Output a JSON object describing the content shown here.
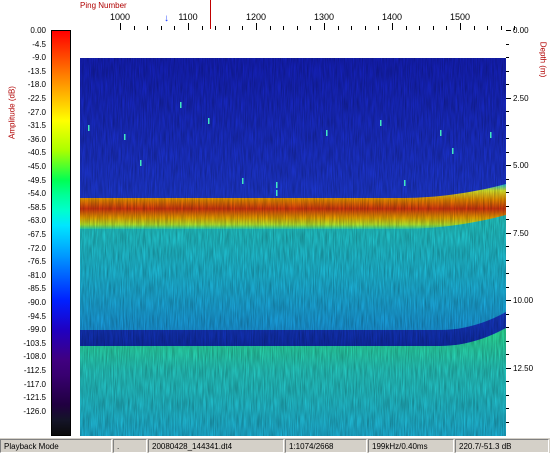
{
  "amplitude_axis": {
    "title": "Amplitude (dB)",
    "labels": [
      "0.00",
      "-4.5",
      "-9.0",
      "-13.5",
      "-18.0",
      "-22.5",
      "-27.0",
      "-31.5",
      "-36.0",
      "-40.5",
      "-45.0",
      "-49.5",
      "-54.0",
      "-58.5",
      "-63.0",
      "-67.5",
      "-72.0",
      "-76.5",
      "-81.0",
      "-85.5",
      "-90.0",
      "-94.5",
      "-99.0",
      "-103.5",
      "-108.0",
      "-112.5",
      "-117.0",
      "-121.5",
      "-126.0"
    ],
    "scale_colors": [
      "#ff0000",
      "#ff2a00",
      "#ff5500",
      "#ff8000",
      "#ffaa00",
      "#ffd400",
      "#ffff00",
      "#d4ff00",
      "#aaff00",
      "#55ff2a",
      "#00ff55",
      "#00ff99",
      "#00ffcc",
      "#00e6ff",
      "#00c0ff",
      "#0099ff",
      "#0070ff",
      "#0048ff",
      "#0020ff",
      "#1010e0",
      "#2000c0",
      "#3000a0",
      "#400080",
      "#380070",
      "#2c0058",
      "#200040",
      "#141428",
      "#0a0a0a"
    ]
  },
  "ping_axis": {
    "title": "Ping Number",
    "ticks": [
      "1000",
      "1100",
      "1200",
      "1300",
      "1400",
      "1500"
    ]
  },
  "depth_axis": {
    "title": "Depth (m)",
    "ticks": [
      "0.00",
      "2.50",
      "5.00",
      "7.50",
      "10.00",
      "12.50"
    ]
  },
  "palette": {
    "background": "#000090",
    "water_deep": "#1a2ad8",
    "water_mid": "#2a6af0",
    "bottom_red": "#e03010",
    "bottom_orange": "#ff9000",
    "bottom_yellow": "#f0ff20",
    "sub_cyan": "#20d0e0",
    "sub_green": "#30e060",
    "deep_blue": "#1028c0"
  },
  "status_bar": {
    "mode": "Playback Mode",
    "dot": ".",
    "file": "20080428_144341.dt4",
    "position": "1:1074/2668",
    "frequency": "199kHz/0.40ms",
    "reading": "220.7/-51.3 dB"
  }
}
